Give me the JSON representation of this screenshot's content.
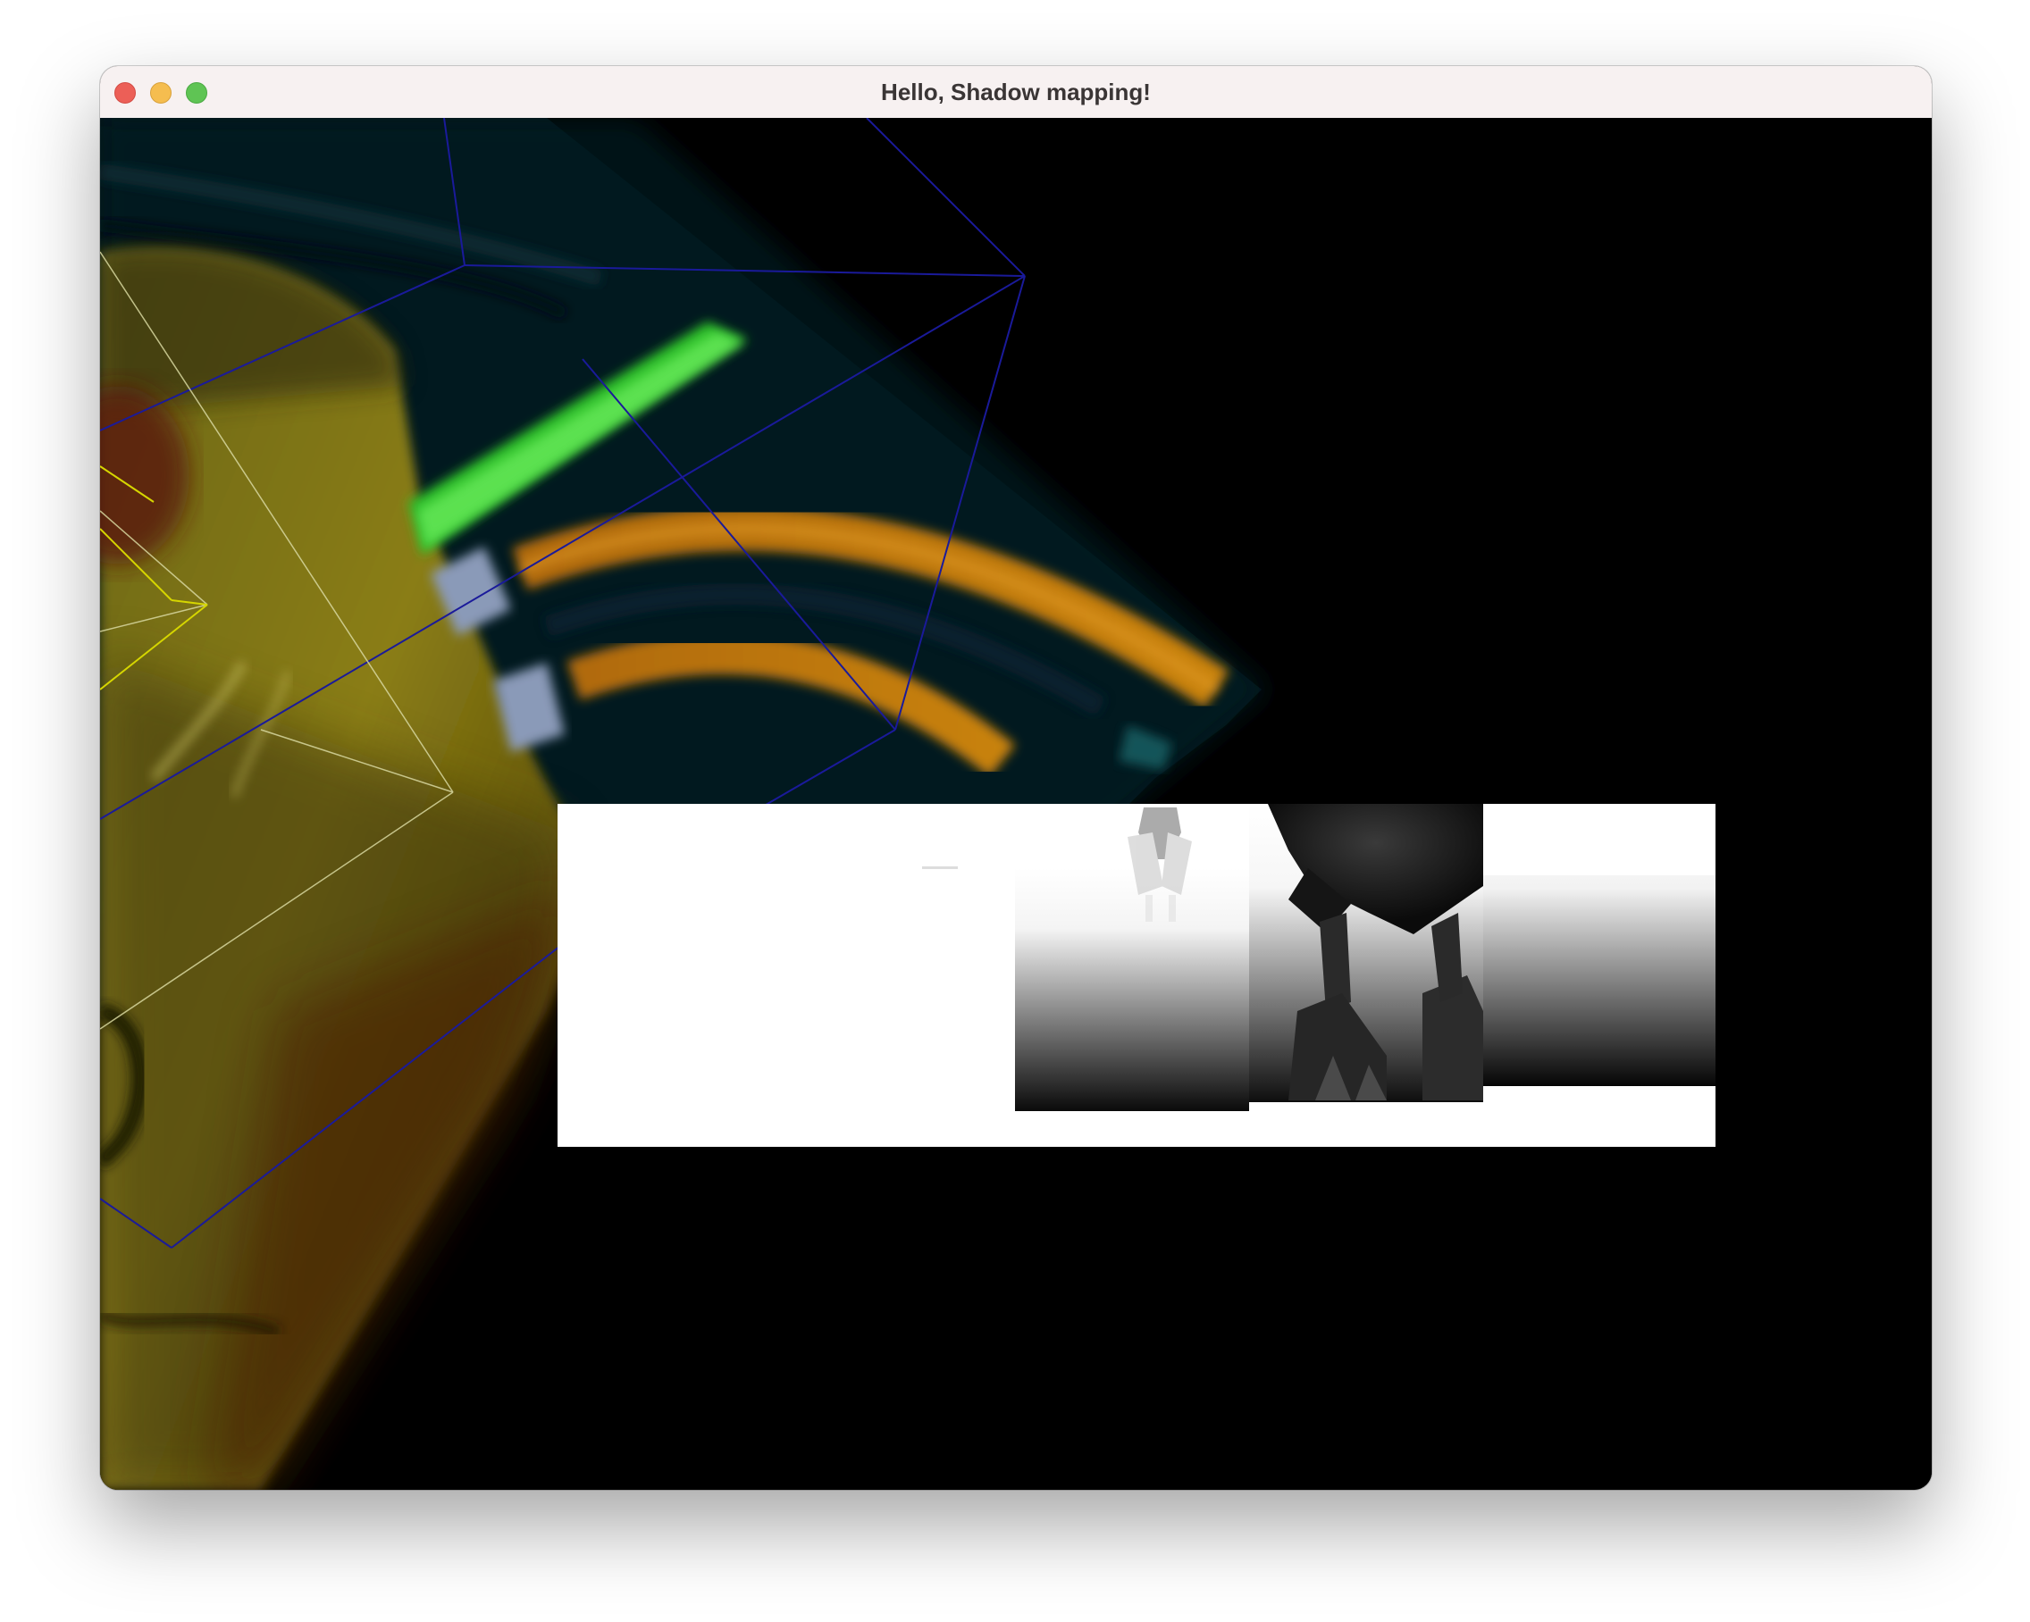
{
  "window": {
    "title": "Hello, Shadow mapping!"
  },
  "controls": {
    "close": "close-button",
    "minimize": "minimize-button",
    "maximize": "maximize-button"
  },
  "colors": {
    "close": "#ec5f57",
    "minimize": "#f5bd4f",
    "maximize": "#5fc454",
    "viewport_background": "#000000",
    "frustum_wireframe": "#1a1a8c",
    "light_wireframe": "#d8d8a0"
  },
  "scene": {
    "description_icons": [
      "textured-floor-plane",
      "camera-frustum-wireframe",
      "light-frustum-wireframe",
      "shadow-map-debug-panel"
    ]
  }
}
